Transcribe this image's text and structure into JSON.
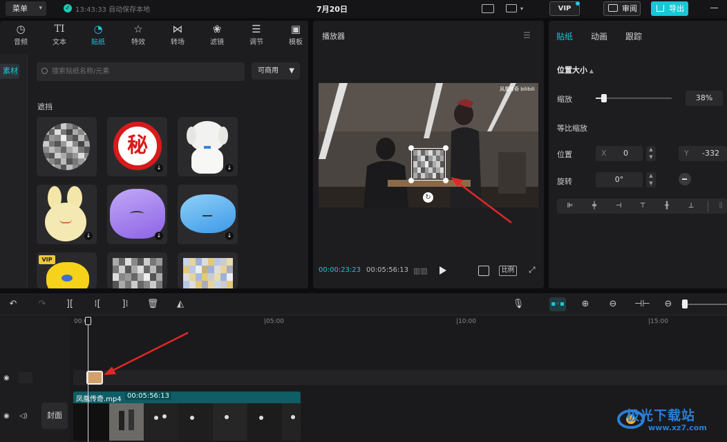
{
  "topbar": {
    "menu_label": "菜单",
    "save_status": "13:43:33 自动保存本地",
    "project_title": "7月20日",
    "vip_label": "VIP",
    "review_label": "审阅",
    "export_label": "导出"
  },
  "media_tabs": [
    {
      "label": "音频",
      "icon": "music-note-icon"
    },
    {
      "label": "文本",
      "icon": "text-icon"
    },
    {
      "label": "贴纸",
      "icon": "sticker-icon"
    },
    {
      "label": "特效",
      "icon": "sparkle-icon"
    },
    {
      "label": "转场",
      "icon": "transition-icon"
    },
    {
      "label": "滤镜",
      "icon": "filter-icon"
    },
    {
      "label": "调节",
      "icon": "adjust-icon"
    },
    {
      "label": "模板",
      "icon": "template-icon"
    }
  ],
  "sidebar": {
    "item": "素材"
  },
  "search": {
    "placeholder": "搜索贴纸名称/元素"
  },
  "filter_label": "可商用",
  "section_label": "遮挡",
  "stickers": {
    "seal_char": "秘",
    "vip_badge": "VIP"
  },
  "player": {
    "title": "播放器",
    "current_time": "00:00:23:23",
    "total_time": "00:05:56:13",
    "ratio_label": "比例",
    "video_watermark": "风凰传奇 bilibili"
  },
  "inspector": {
    "tabs": [
      "贴纸",
      "动画",
      "跟踪"
    ],
    "section": "位置大小",
    "scale_label": "缩放",
    "scale_value": "38%",
    "scale_fraction": 0.38,
    "uniform_scale_label": "等比缩放",
    "position_label": "位置",
    "x_label": "X",
    "x_value": "0",
    "y_label": "Y",
    "y_value": "-332",
    "rotate_label": "旋转",
    "rotate_value": "0°"
  },
  "timeline": {
    "ruler_labels": [
      "00:00",
      "|05:00",
      "|10:00",
      "|15:00"
    ],
    "cover_label": "封面",
    "clip_name": "凤凰传奇.mp4",
    "clip_duration": "00:05:56:13"
  },
  "watermark": {
    "name": "极光下载站",
    "url": "www.xz7.com"
  },
  "colors": {
    "accent": "#18c9d8",
    "clip": "#0f5d65",
    "arrow": "#e02828"
  }
}
